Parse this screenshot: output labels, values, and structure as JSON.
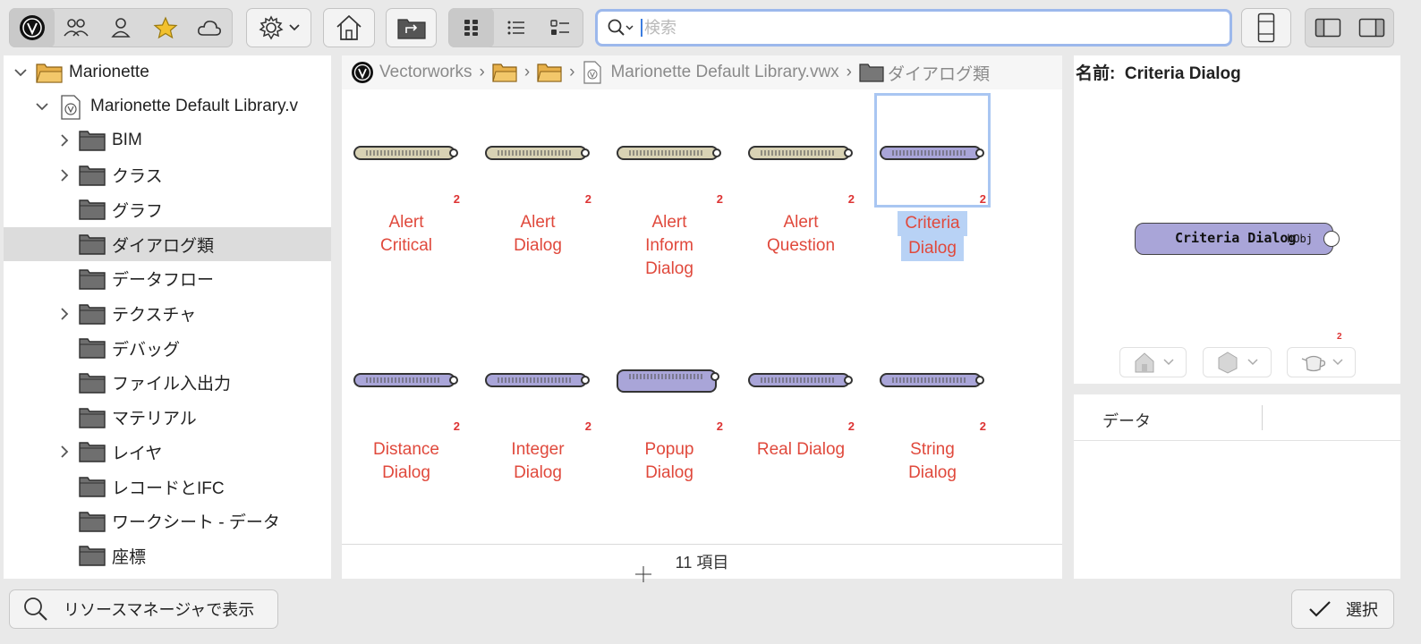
{
  "toolbar": {
    "library_icons": [
      "vectorworks-logo-icon",
      "users-icon",
      "user-icon",
      "star-icon",
      "cloud-icon"
    ],
    "settings_icon": "gear-icon",
    "home_icon": "home-icon",
    "folder_up_icon": "folder-up-icon",
    "view_modes": [
      "grid-view-icon",
      "list-view-icon",
      "detail-list-icon"
    ],
    "search": {
      "placeholder": "検索"
    },
    "accent": "#e0493c"
  },
  "tree": {
    "root": "Marionette",
    "file": "Marionette Default Library.v",
    "folders": [
      {
        "label": "BIM",
        "expandable": true
      },
      {
        "label": "クラス",
        "expandable": true
      },
      {
        "label": "グラフ",
        "expandable": false
      },
      {
        "label": "ダイアログ類",
        "expandable": false,
        "selected": true
      },
      {
        "label": "データフロー",
        "expandable": false
      },
      {
        "label": "テクスチャ",
        "expandable": true
      },
      {
        "label": "デバッグ",
        "expandable": false
      },
      {
        "label": "ファイル入出力",
        "expandable": false
      },
      {
        "label": "マテリアル",
        "expandable": false
      },
      {
        "label": "レイヤ",
        "expandable": true
      },
      {
        "label": "レコードとIFC",
        "expandable": false
      },
      {
        "label": "ワークシート - データ",
        "expandable": false
      },
      {
        "label": "座標",
        "expandable": false
      }
    ]
  },
  "breadcrumb": {
    "items": [
      "Vectorworks",
      "",
      "",
      "Marionette Default Library.vwx",
      "ダイアログ類"
    ]
  },
  "grid": {
    "items": [
      {
        "label": "Alert Critical",
        "line1": "Alert",
        "line2": "Critical",
        "line3": "",
        "badge": "2",
        "color": "#d8d2b4"
      },
      {
        "label": "Alert Dialog",
        "line1": "Alert",
        "line2": "Dialog",
        "line3": "",
        "badge": "2",
        "color": "#d8d2b4"
      },
      {
        "label": "Alert Inform Dialog",
        "line1": "Alert",
        "line2": "Inform",
        "line3": "Dialog",
        "badge": "2",
        "color": "#d8d2b4"
      },
      {
        "label": "Alert Question",
        "line1": "Alert",
        "line2": "Question",
        "line3": "",
        "badge": "2",
        "color": "#d8d2b4"
      },
      {
        "label": "Criteria Dialog",
        "line1": "Criteria",
        "line2": "Dialog",
        "line3": "",
        "badge": "2",
        "color": "#a9a5d8",
        "selected": true
      },
      {
        "label": "Distance Dialog",
        "line1": "Distance",
        "line2": "Dialog",
        "line3": "",
        "badge": "2",
        "color": "#a9a5d8"
      },
      {
        "label": "Integer Dialog",
        "line1": "Integer",
        "line2": "Dialog",
        "line3": "",
        "badge": "2",
        "color": "#a9a5d8"
      },
      {
        "label": "Popup Dialog",
        "line1": "Popup",
        "line2": "Dialog",
        "line3": "",
        "badge": "2",
        "color": "#a9a5d8"
      },
      {
        "label": "Real Dialog",
        "line1": "Real Dialog",
        "line2": "",
        "line3": "",
        "badge": "2",
        "color": "#a9a5d8"
      },
      {
        "label": "String Dialog",
        "line1": "String",
        "line2": "Dialog",
        "line3": "",
        "badge": "2",
        "color": "#a9a5d8"
      }
    ],
    "status": "11 項目"
  },
  "preview": {
    "name_label": "名前:",
    "name_value": "Criteria Dialog",
    "node_title": "Criteria Dialog",
    "node_port": "hObj",
    "badge": "2",
    "mini_icons": [
      "house-icon",
      "material-icon",
      "teapot-icon"
    ]
  },
  "data_panel": {
    "header": "データ"
  },
  "footer": {
    "show_in_rm_label": "リソースマネージャで表示",
    "select_label": "選択"
  }
}
